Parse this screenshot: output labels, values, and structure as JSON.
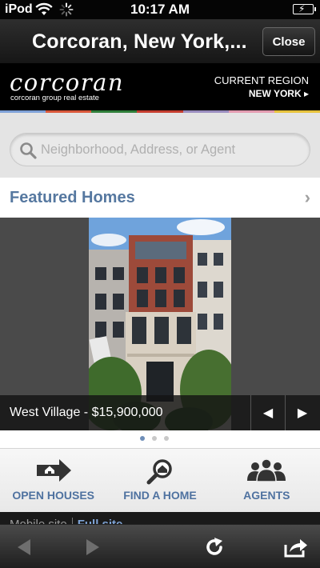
{
  "status_bar": {
    "carrier": "iPod",
    "time": "10:17 AM"
  },
  "title_bar": {
    "title": "Corcoran, New York,...",
    "close_label": "Close"
  },
  "header": {
    "logo_text": "corcoran",
    "tagline": "corcoran group real estate",
    "region_label": "CURRENT REGION",
    "region_value": "NEW YORK ▸",
    "strip_colors": [
      "#7fa2d8",
      "#d9573a",
      "#2f7f3a",
      "#c53d2f",
      "#9b8ec0",
      "#e39bb0",
      "#e7c33c"
    ]
  },
  "search": {
    "placeholder": "Neighborhood, Address, or Agent",
    "value": ""
  },
  "featured": {
    "label": "Featured Homes",
    "chevron": "›"
  },
  "slider": {
    "caption": "West Village - $15,900,000",
    "prev_label": "◀",
    "next_label": "▶",
    "page_count": 3,
    "active_page": 1
  },
  "quick_nav": [
    {
      "label": "OPEN HOUSES",
      "icon": "house-arrow-icon"
    },
    {
      "label": "FIND A HOME",
      "icon": "magnifier-house-icon"
    },
    {
      "label": "AGENTS",
      "icon": "people-icon"
    }
  ],
  "footer": {
    "mobile_site": "Mobile site",
    "full_site": "Full site"
  },
  "colors": {
    "accent": "#5678a0",
    "nav_label": "#4f72a0",
    "dot_active": "#6e8eb8"
  }
}
